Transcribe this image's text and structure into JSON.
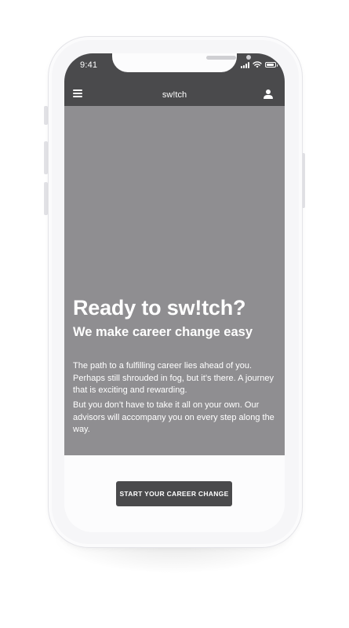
{
  "status_bar": {
    "time": "9:41",
    "signal_icon": "cellular-signal-icon",
    "wifi_icon": "wifi-icon",
    "battery_icon": "battery-icon"
  },
  "nav": {
    "menu_icon": "hamburger-menu-icon",
    "title": "sw!tch",
    "profile_icon": "user-profile-icon"
  },
  "hero": {
    "title": "Ready to sw!tch?",
    "subtitle": "We make career change easy",
    "paragraph_1": "The path to a fulfilling career lies ahead of you. Perhaps still shrouded in fog, but it’s there. A journey that is exciting and rewarding.",
    "paragraph_2": "But you don’t have to take it all on your own. Our advisors will accompany you on every step along the way."
  },
  "cta": {
    "label": "START YOUR CAREER CHANGE"
  },
  "colors": {
    "bar": "#4a4a4c",
    "hero": "#8f8e91",
    "button": "#4a4a4c",
    "text_on_dark": "#ffffff"
  }
}
